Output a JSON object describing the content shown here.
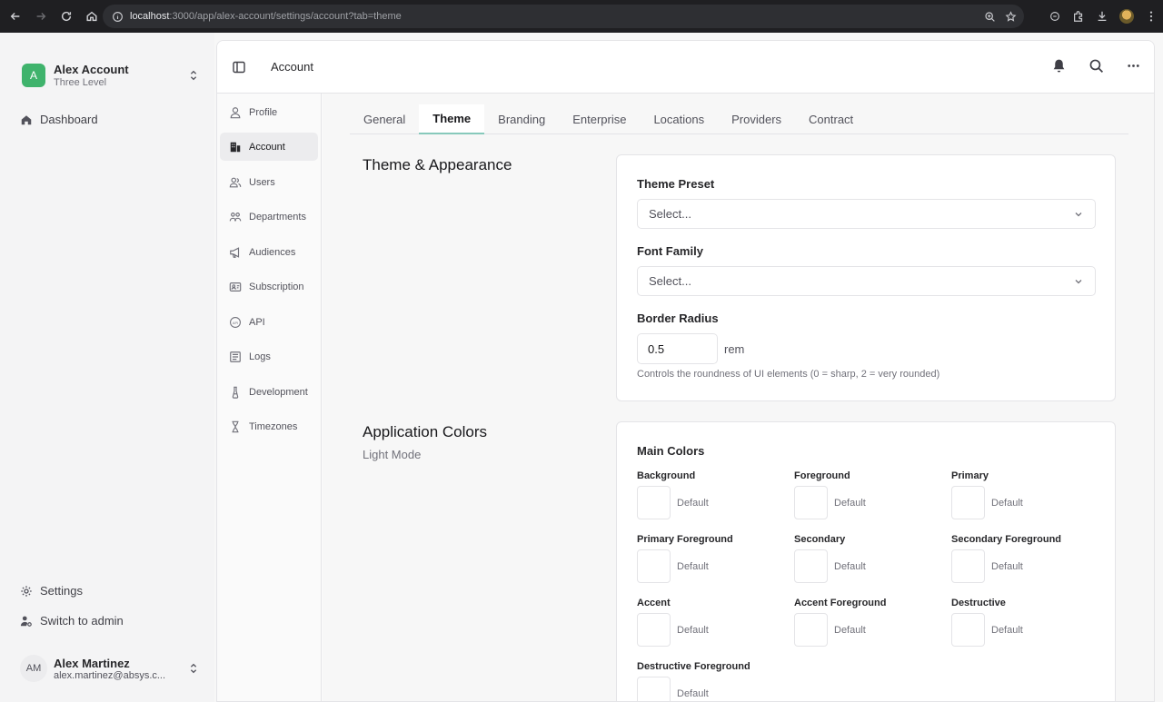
{
  "browser": {
    "url_host": "localhost",
    "url_rest": ":3000/app/alex-account/settings/account?tab=theme"
  },
  "sidebar": {
    "account_initial": "A",
    "account_name": "Alex Account",
    "account_sub": "Three Level",
    "dashboard_label": "Dashboard",
    "settings_label": "Settings",
    "switch_admin_label": "Switch to admin",
    "user_initials": "AM",
    "user_name": "Alex Martinez",
    "user_email": "alex.martinez@absys.c..."
  },
  "header": {
    "title": "Account"
  },
  "subnav": {
    "items": [
      {
        "label": "Profile",
        "icon": "user-icon"
      },
      {
        "label": "Account",
        "icon": "building-icon"
      },
      {
        "label": "Users",
        "icon": "users-icon"
      },
      {
        "label": "Departments",
        "icon": "departments-icon"
      },
      {
        "label": "Audiences",
        "icon": "megaphone-icon"
      },
      {
        "label": "Subscription",
        "icon": "subscription-icon"
      },
      {
        "label": "API",
        "icon": "api-icon"
      },
      {
        "label": "Logs",
        "icon": "logs-icon"
      },
      {
        "label": "Development",
        "icon": "flask-icon"
      },
      {
        "label": "Timezones",
        "icon": "hourglass-icon"
      }
    ]
  },
  "tabs": [
    "General",
    "Theme",
    "Branding",
    "Enterprise",
    "Locations",
    "Providers",
    "Contract"
  ],
  "theme_section": {
    "title": "Theme & Appearance",
    "preset_label": "Theme Preset",
    "preset_placeholder": "Select...",
    "font_label": "Font Family",
    "font_placeholder": "Select...",
    "radius_label": "Border Radius",
    "radius_value": "0.5",
    "radius_unit": "rem",
    "radius_hint": "Controls the roundness of UI elements (0 = sharp, 2 = very rounded)"
  },
  "colors_section": {
    "title": "Application Colors",
    "subtitle": "Light Mode",
    "group_title": "Main Colors",
    "swatches": [
      {
        "label": "Background",
        "value": "Default"
      },
      {
        "label": "Foreground",
        "value": "Default"
      },
      {
        "label": "Primary",
        "value": "Default"
      },
      {
        "label": "Primary Foreground",
        "value": "Default"
      },
      {
        "label": "Secondary",
        "value": "Default"
      },
      {
        "label": "Secondary Foreground",
        "value": "Default"
      },
      {
        "label": "Accent",
        "value": "Default"
      },
      {
        "label": "Accent Foreground",
        "value": "Default"
      },
      {
        "label": "Destructive",
        "value": "Default"
      },
      {
        "label": "Destructive Foreground",
        "value": "Default"
      }
    ]
  },
  "colors": {
    "accent_tab": "#87c9bb",
    "account_avatar": "#3fb36c"
  }
}
